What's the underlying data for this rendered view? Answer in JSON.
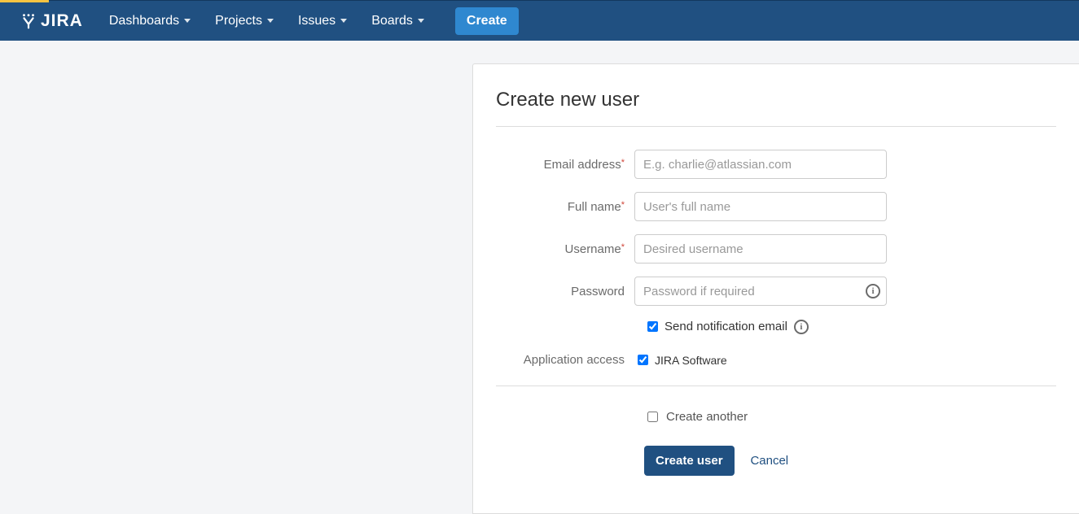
{
  "nav": {
    "dashboards": "Dashboards",
    "projects": "Projects",
    "issues": "Issues",
    "boards": "Boards",
    "create": "Create",
    "logo_text": "JIRA"
  },
  "form": {
    "title": "Create new user",
    "email_label": "Email address",
    "email_placeholder": "E.g. charlie@atlassian.com",
    "fullname_label": "Full name",
    "fullname_placeholder": "User's full name",
    "username_label": "Username",
    "username_placeholder": "Desired username",
    "password_label": "Password",
    "password_placeholder": "Password if required",
    "send_notification_label": "Send notification email",
    "app_access_label": "Application access",
    "jira_software_label": "JIRA Software",
    "create_another_label": "Create another",
    "submit_label": "Create user",
    "cancel_label": "Cancel",
    "send_notification_checked": true,
    "jira_software_checked": true,
    "create_another_checked": false
  },
  "colors": {
    "navbar": "#205081",
    "accent_button": "#2f88d0",
    "required": "#d04437"
  }
}
